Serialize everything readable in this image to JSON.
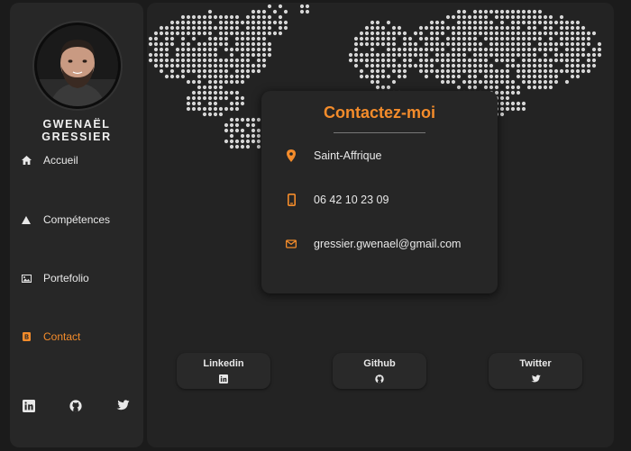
{
  "profile": {
    "name": "GWENAËL GRESSIER",
    "avatar_icon": "avatar-photo"
  },
  "nav": {
    "items": [
      {
        "label": "Accueil",
        "icon": "home-icon",
        "active": false
      },
      {
        "label": "Compétences",
        "icon": "triangle-icon",
        "active": false
      },
      {
        "label": "Portefolio",
        "icon": "image-icon",
        "active": false
      },
      {
        "label": "Contact",
        "icon": "contact-card-icon",
        "active": true
      }
    ]
  },
  "sidebar_social": [
    {
      "icon": "linkedin-icon"
    },
    {
      "icon": "github-icon"
    },
    {
      "icon": "twitter-icon"
    }
  ],
  "contact_card": {
    "title": "Contactez-moi",
    "location": "Saint-Affrique",
    "phone": "06 42 10 23 09",
    "email": "gressier.gwenael@gmail.com"
  },
  "social_buttons": [
    {
      "label": "Linkedin",
      "icon": "linkedin-icon"
    },
    {
      "label": "Github",
      "icon": "github-icon"
    },
    {
      "label": "Twitter",
      "icon": "twitter-icon"
    }
  ],
  "colors": {
    "accent": "#f48c2b",
    "background": "#1b1b1b",
    "panel": "#272727",
    "map_dots": "#d6d6d6"
  }
}
